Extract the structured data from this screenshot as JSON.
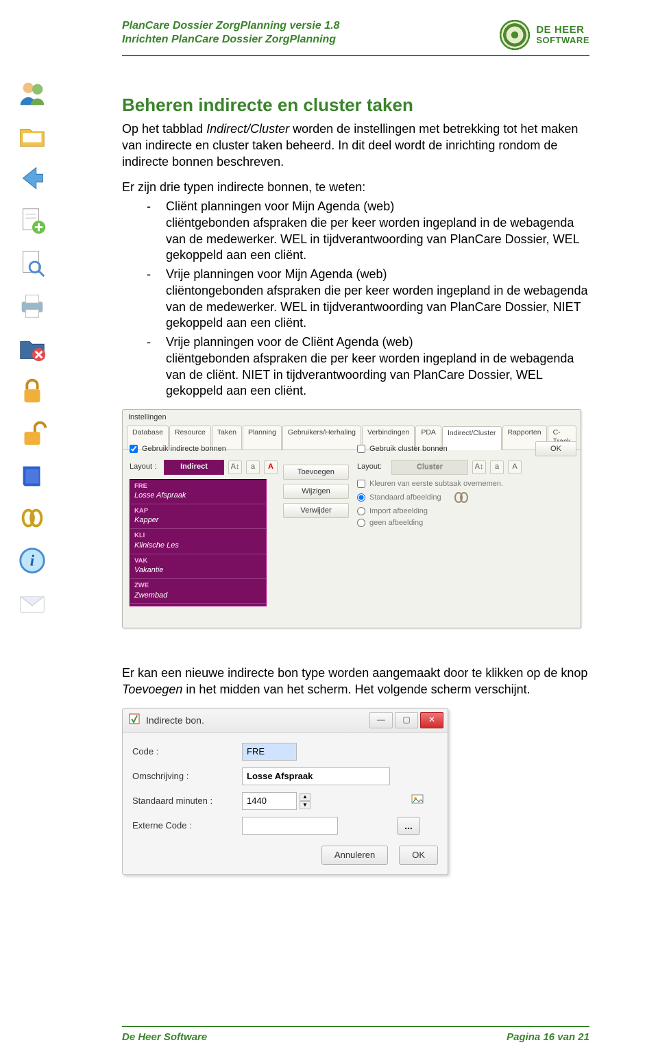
{
  "header": {
    "line1": "PlanCare Dossier ZorgPlanning versie 1.8",
    "line2": "Inrichten PlanCare Dossier ZorgPlanning",
    "brand_top": "DE HEER",
    "brand_sub": "SOFTWARE"
  },
  "footer": {
    "left": "De Heer Software",
    "right": "Pagina 16 van 21"
  },
  "doc": {
    "h1": "Beheren indirecte en cluster taken",
    "intro1a": "Op het tabblad ",
    "intro1_em": "Indirect/Cluster",
    "intro1b": " worden de instellingen met betrekking tot het maken van indirecte en cluster taken beheerd. In dit deel wordt de inrichting rondom de indirecte bonnen beschreven.",
    "p2": "Er zijn drie typen indirecte bonnen, te weten:",
    "b1_title": "Cliënt planningen voor Mijn Agenda (web)",
    "b1_rest": "cliëntgebonden afspraken die per keer worden ingepland in de webagenda van de medewerker. WEL in tijdverantwoording van PlanCare Dossier, WEL gekoppeld aan een cliënt.",
    "b2_title": "Vrije planningen voor Mijn Agenda (web)",
    "b2_rest": "cliëntongebonden afspraken die per keer worden ingepland in de webagenda van de medewerker. WEL in tijdverantwoording van PlanCare Dossier, NIET gekoppeld aan een cliënt.",
    "b3_title": "Vrije planningen voor de Cliënt Agenda (web)",
    "b3_rest": "cliëntgebonden afspraken die per keer worden ingepland in de webagenda van de cliënt. NIET in tijdverantwoording van PlanCare Dossier, WEL gekoppeld aan een cliënt.",
    "outro_a": "Er kan een nieuwe indirecte bon type worden aangemaakt door te klikken op de knop ",
    "outro_em": "Toevoegen",
    "outro_b": " in het midden van het scherm. Het volgende scherm verschijnt."
  },
  "inst": {
    "window_title": "Instellingen",
    "tabs": [
      "Database",
      "Resource",
      "Taken",
      "Planning",
      "Gebruikers/Herhaling",
      "Verbindingen",
      "PDA",
      "Indirect/Cluster",
      "Rapporten",
      "C-Track"
    ],
    "selected_tab": "Indirect/Cluster",
    "chk_indirect": "Gebruik indirecte bonnen",
    "chk_cluster": "Gebruik cluster bonnen",
    "layout_label": "Layout :",
    "indirect_bar": "Indirect",
    "cluster_bar": "Cluster",
    "btn_add": "Toevoegen",
    "btn_edit": "Wijzigen",
    "btn_del": "Verwijder",
    "chk_kleuren": "Kleuren van eerste subtaak overnemen.",
    "rad_std_img": "Standaard afbeelding",
    "rad_imp_img": "Import afbeelding",
    "rad_no_img": "geen afbeelding",
    "ok": "OK",
    "indirect_items": [
      {
        "code": "FRE",
        "name": "Losse Afspraak"
      },
      {
        "code": "KAP",
        "name": "Kapper"
      },
      {
        "code": "KLI",
        "name": "Klinische Les"
      },
      {
        "code": "VAK",
        "name": "Vakantie"
      },
      {
        "code": "ZWE",
        "name": "Zwembad"
      }
    ]
  },
  "bon": {
    "title": "Indirecte bon.",
    "lbl_code": "Code :",
    "lbl_omsch": "Omschrijving :",
    "lbl_min": "Standaard minuten :",
    "lbl_ext": "Externe Code :",
    "val_code": "FRE",
    "val_omsch": "Losse Afspraak",
    "val_min": "1440",
    "val_ext": "",
    "btn_cancel": "Annuleren",
    "btn_ok": "OK"
  }
}
